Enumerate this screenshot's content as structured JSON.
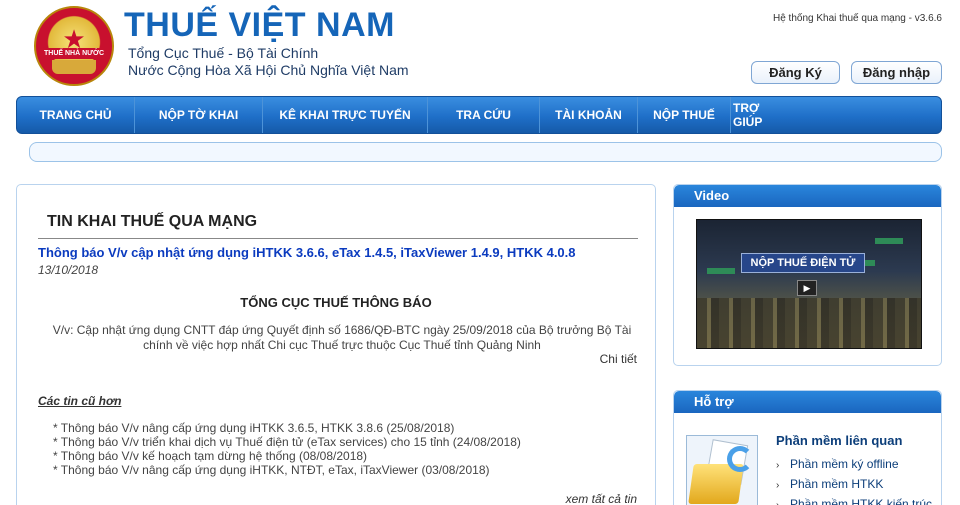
{
  "header": {
    "logo_text": "THUẾ NHÀ NƯỚC",
    "title": "THUẾ VIỆT NAM",
    "subtitle_1": "Tổng Cục Thuế - Bộ Tài Chính",
    "subtitle_2": "Nước Cộng Hòa Xã Hội Chủ Nghĩa Việt Nam",
    "version": "Hệ thống Khai thuế qua mạng - v3.6.6",
    "register_label": "Đăng Ký",
    "login_label": "Đăng nhập"
  },
  "nav": {
    "items": [
      {
        "label": "TRANG CHỦ"
      },
      {
        "label": "NỘP TỜ KHAI"
      },
      {
        "label": "KÊ KHAI TRỰC TUYẾN"
      },
      {
        "label": "TRA CỨU"
      },
      {
        "label": "TÀI KHOẢN"
      },
      {
        "label": "NỘP THUẾ"
      },
      {
        "label": "TRỢ GIÚP"
      }
    ]
  },
  "main": {
    "title": "TIN KHAI THUẾ QUA MẠNG",
    "news_title": "Thông báo V/v cập nhật ứng dụng iHTKK 3.6.6, eTax 1.4.5, iTaxViewer 1.4.9, HTKK 4.0.8",
    "news_date": "13/10/2018",
    "notice_heading": "TỔNG CỤC THUẾ THÔNG BÁO",
    "notice_body": "V/v: Cập nhật ứng dụng CNTT đáp ứng Quyết định số 1686/QĐ-BTC ngày 25/09/2018 của Bộ trưởng Bộ Tài chính về việc hợp nhất Chi cục Thuế trực thuộc Cục Thuế tỉnh Quảng Ninh",
    "detail_label": "Chi tiết",
    "older_title": "Các tin cũ hơn",
    "older_items": [
      "* Thông báo V/v nâng cấp ứng dụng iHTKK 3.6.5, HTKK 3.8.6 (25/08/2018)",
      "* Thông báo V/v triển khai dịch vụ Thuế điện tử (eTax services) cho 15 tỉnh (24/08/2018)",
      "* Thông báo V/v kế hoạch tạm dừng hệ thống (08/08/2018)",
      "* Thông báo V/v nâng cấp ứng dụng iHTKK, NTĐT, eTax, iTaxViewer (03/08/2018)"
    ],
    "see_all_label": "xem tất cả tin"
  },
  "video_panel": {
    "title": "Video",
    "video_banner": "NỘP THUẾ ĐIỆN TỬ"
  },
  "support_panel": {
    "title": "Hỗ trợ",
    "section_title": "Phần mềm liên quan",
    "links": [
      "Phần mềm ký offline",
      "Phần mềm HTKK",
      "Phần mềm HTKK kiến trúc"
    ]
  }
}
